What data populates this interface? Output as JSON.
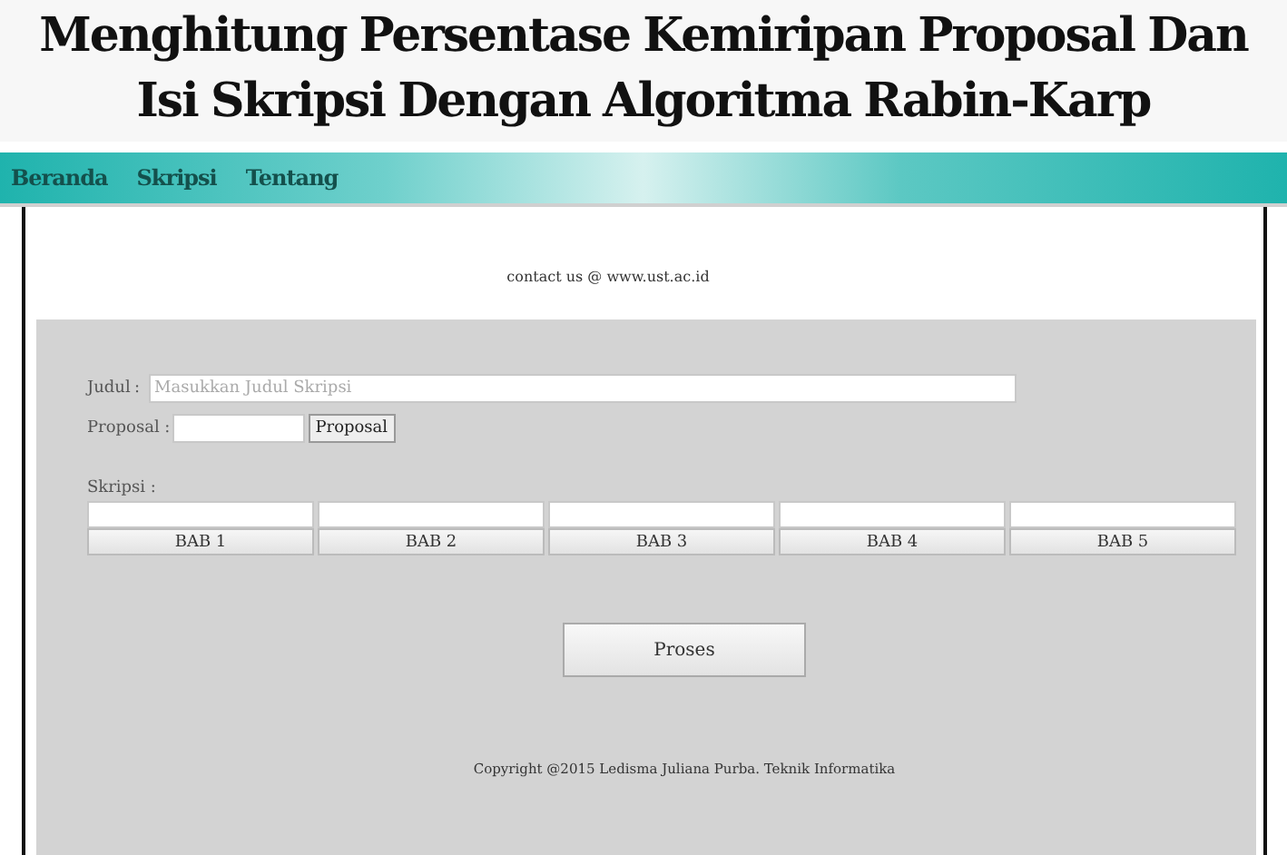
{
  "title": "Menghitung Persentase Kemiripan Proposal Dan Isi Skripsi Dengan Algoritma Rabin-Karp",
  "nav": [
    {
      "label": "Beranda"
    },
    {
      "label": "Skripsi"
    },
    {
      "label": "Tentang"
    }
  ],
  "contact": "contact us @ www.ust.ac.id",
  "form": {
    "judul_label": "Judul",
    "judul_colon": ":",
    "judul_placeholder": "Masukkan Judul Skripsi",
    "proposal_label": "Proposal :",
    "proposal_button": "Proposal",
    "skripsi_label": "Skripsi :",
    "chapters": [
      {
        "button": "BAB 1"
      },
      {
        "button": "BAB 2"
      },
      {
        "button": "BAB 3"
      },
      {
        "button": "BAB 4"
      },
      {
        "button": "BAB 5"
      }
    ],
    "submit": "Proses"
  },
  "footer": "Copyright @2015 Ledisma Juliana Purba. Teknik Informatika"
}
